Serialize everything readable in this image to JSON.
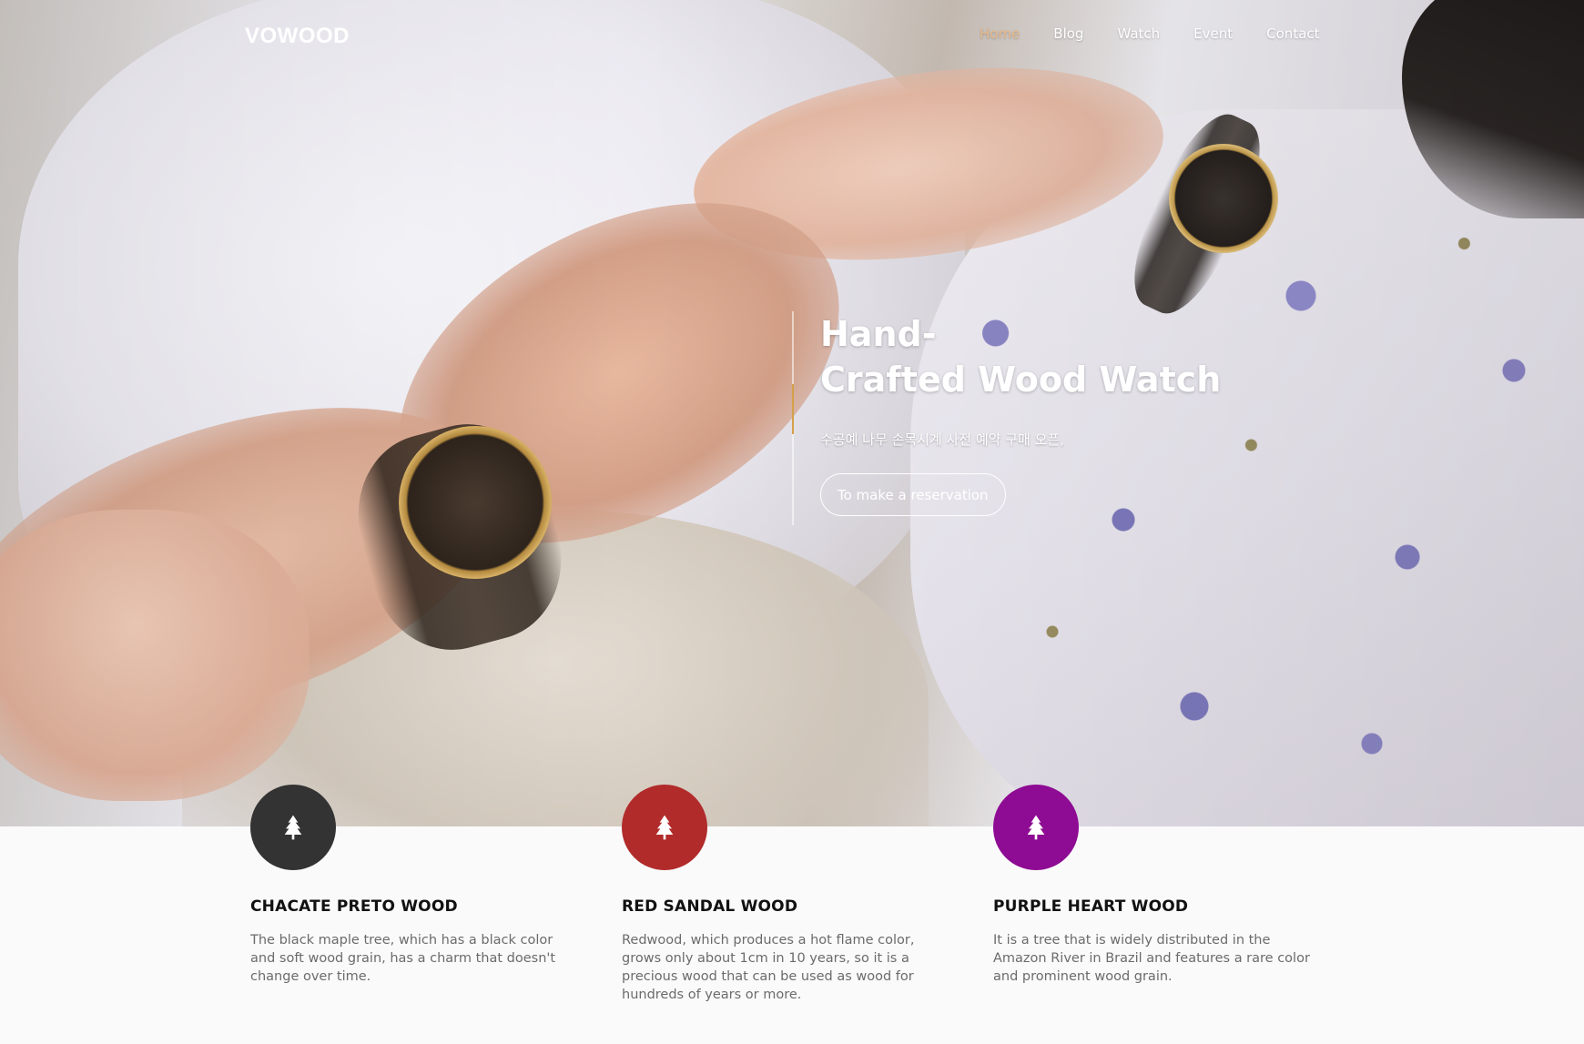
{
  "brand": {
    "logo": "VOWOOD"
  },
  "nav": {
    "items": [
      {
        "label": "Home",
        "active": true
      },
      {
        "label": "Blog",
        "active": false
      },
      {
        "label": "Watch",
        "active": false
      },
      {
        "label": "Event",
        "active": false
      },
      {
        "label": "Contact",
        "active": false
      }
    ],
    "active_color": "#e7b88a"
  },
  "hero": {
    "title_line1": "Hand-",
    "title_line2": "Crafted Wood Watch",
    "subtitle": "수공예 나무 손목시계 사전 예약 구매 오픈,",
    "cta_label": "To make a reservation",
    "accent_color": "#d4a04a"
  },
  "features": [
    {
      "title": "CHACATE PRETO WOOD",
      "description": "The black maple tree, which has a black color and soft wood grain, has a charm that doesn't change over time.",
      "color": "#333333",
      "icon": "tree-icon"
    },
    {
      "title": "RED SANDAL WOOD",
      "description": "Redwood, which produces a hot flame color, grows only about 1cm in 10 years, so it is a precious wood that can be used as wood for hundreds of years or more.",
      "color": "#b12b2b",
      "icon": "tree-icon"
    },
    {
      "title": "PURPLE HEART WOOD",
      "description": "It is a tree that is widely distributed in the Amazon River in Brazil and features a rare color and prominent wood grain.",
      "color": "#8e0b93",
      "icon": "tree-icon"
    }
  ]
}
